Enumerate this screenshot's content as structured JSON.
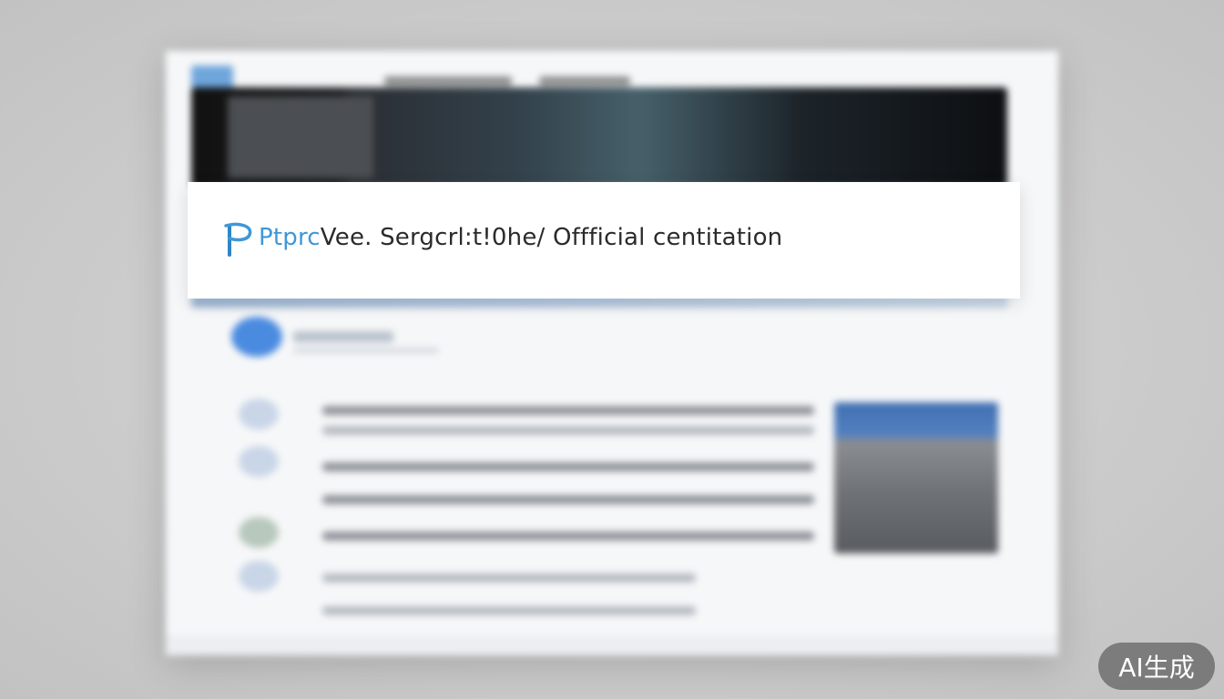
{
  "banner": {
    "brand_text": "Ptprc",
    "title_rest": "Vee. Sergcrl:t!0he/ Offficial centitation"
  },
  "badge": {
    "label": "AI生成"
  },
  "colors": {
    "brand_blue": "#3f97d6",
    "avatar_blue": "#4a8be0",
    "badge_bg": "#6e6e6e"
  },
  "icons": {
    "logo": "p-logo-icon"
  }
}
